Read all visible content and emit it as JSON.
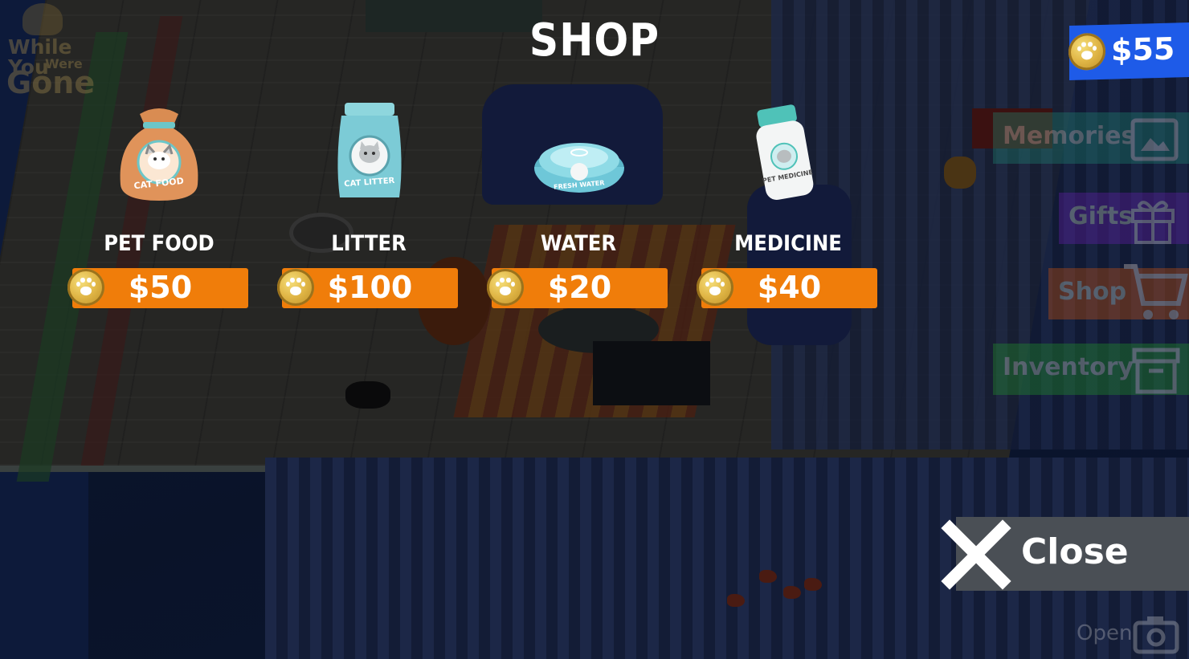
{
  "game_logo": {
    "line1": "While You",
    "line2": "Were",
    "line3": "Gone"
  },
  "shop": {
    "title": "SHOP"
  },
  "wallet": {
    "amount": "$55",
    "icon": "paw-coin-icon"
  },
  "items": [
    {
      "name": "PET FOOD",
      "price": "$50",
      "icon": "cat-food-bag-icon",
      "packaging_text": "CAT FOOD"
    },
    {
      "name": "LITTER",
      "price": "$100",
      "icon": "cat-litter-bag-icon",
      "packaging_text": "CAT LITTER"
    },
    {
      "name": "WATER",
      "price": "$20",
      "icon": "water-bowl-icon",
      "packaging_text": "FRESH WATER"
    },
    {
      "name": "MEDICINE",
      "price": "$40",
      "icon": "medicine-bottle-icon",
      "packaging_text": "PET MEDICINE"
    }
  ],
  "side_menu": [
    {
      "label": "Memories",
      "icon": "picture-icon",
      "color": "#1f8a74"
    },
    {
      "label": "Gifts",
      "icon": "gift-icon",
      "color": "#6a1fb5"
    },
    {
      "label": "Shop",
      "icon": "cart-icon",
      "color": "#d4560c"
    },
    {
      "label": "Inventory",
      "icon": "archive-box-icon",
      "color": "#239b2a"
    }
  ],
  "close_button": {
    "label": "Close",
    "icon": "close-x-icon"
  },
  "camera_button": {
    "label": "Open",
    "icon": "camera-icon"
  },
  "colors": {
    "price_button": "#f07d0a",
    "wallet_bg": "#1e5be8",
    "coin": "#e1b747"
  }
}
